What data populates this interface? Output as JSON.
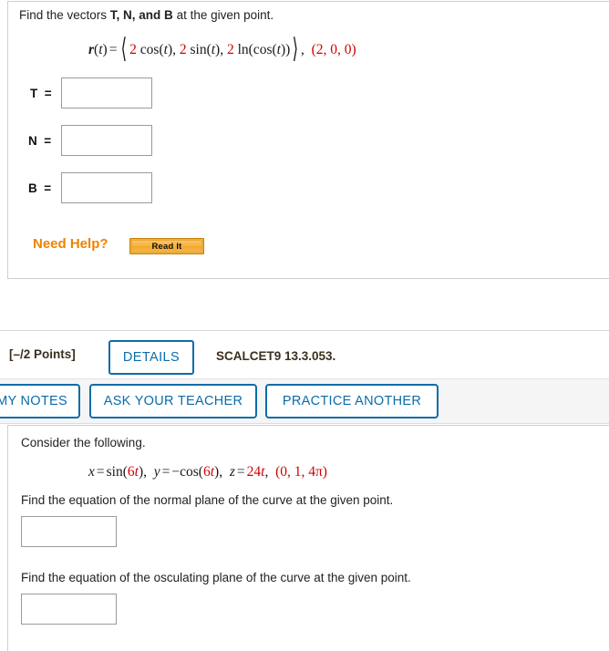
{
  "problem_top": {
    "prompt_before": "Find the vectors ",
    "prompt_vars": "T, N, and B",
    "prompt_after": " at the given point.",
    "equation": {
      "lhs_r": "r",
      "lhs_paren_open": "(",
      "lhs_t": "t",
      "lhs_paren_close": ")",
      "equals": "=",
      "comp1_coef": "2",
      "comp1_fn": " cos(",
      "comp1_var": "t",
      "comp1_tail": "),",
      "comp2_coef": "2",
      "comp2_fn": " sin(",
      "comp2_var": "t",
      "comp2_tail": "),",
      "comp3_coef": "2",
      "comp3_fn": " ln(cos(",
      "comp3_var": "t",
      "comp3_tail": "))",
      "after_bracket": ",",
      "point": "(2, 0, 0)",
      "point_x": "2",
      "point_y": "0",
      "point_z": "0"
    },
    "answers": [
      {
        "label": "T",
        "equals": "=",
        "value": ""
      },
      {
        "label": "N",
        "equals": "=",
        "value": ""
      },
      {
        "label": "B",
        "equals": "=",
        "value": ""
      }
    ],
    "need_help_label": "Need Help?",
    "read_it_label": "Read It"
  },
  "problem_bottom": {
    "points_label": "[–/2 Points]",
    "details_label": "DETAILS",
    "assignment_code": "SCALCET9 13.3.053.",
    "actions": [
      {
        "label": "MY NOTES"
      },
      {
        "label": "ASK YOUR TEACHER"
      },
      {
        "label": "PRACTICE ANOTHER"
      }
    ],
    "consider_text": "Consider the following.",
    "param_eq": {
      "x_var": "x",
      "x_eq": "=",
      "x_fn": "sin(",
      "x_coef": "6",
      "x_t": "t",
      "x_tail": "),",
      "y_var": "y",
      "y_eq": "=",
      "y_fn": "−cos(",
      "y_coef": "6",
      "y_t": "t",
      "y_tail": "),",
      "z_var": "z",
      "z_eq": "=",
      "z_coef": "24",
      "z_t": "t",
      "z_tail": ",",
      "point": "(0, 1, 4π)",
      "point_x": "0",
      "point_y": "1",
      "point_z": "4π"
    },
    "normal_plane_prompt": "Find the equation of the normal plane of the curve at the given point.",
    "normal_plane_value": "",
    "osculating_plane_prompt": "Find the equation of the osculating plane of the curve at the given point.",
    "osculating_plane_value": ""
  },
  "colors": {
    "accent_blue": "#0b6ca8",
    "need_help_orange": "#ef8200",
    "math_red": "#d00000",
    "band_gray": "#f5f5f5",
    "border_gray": "#cfcfcf"
  }
}
